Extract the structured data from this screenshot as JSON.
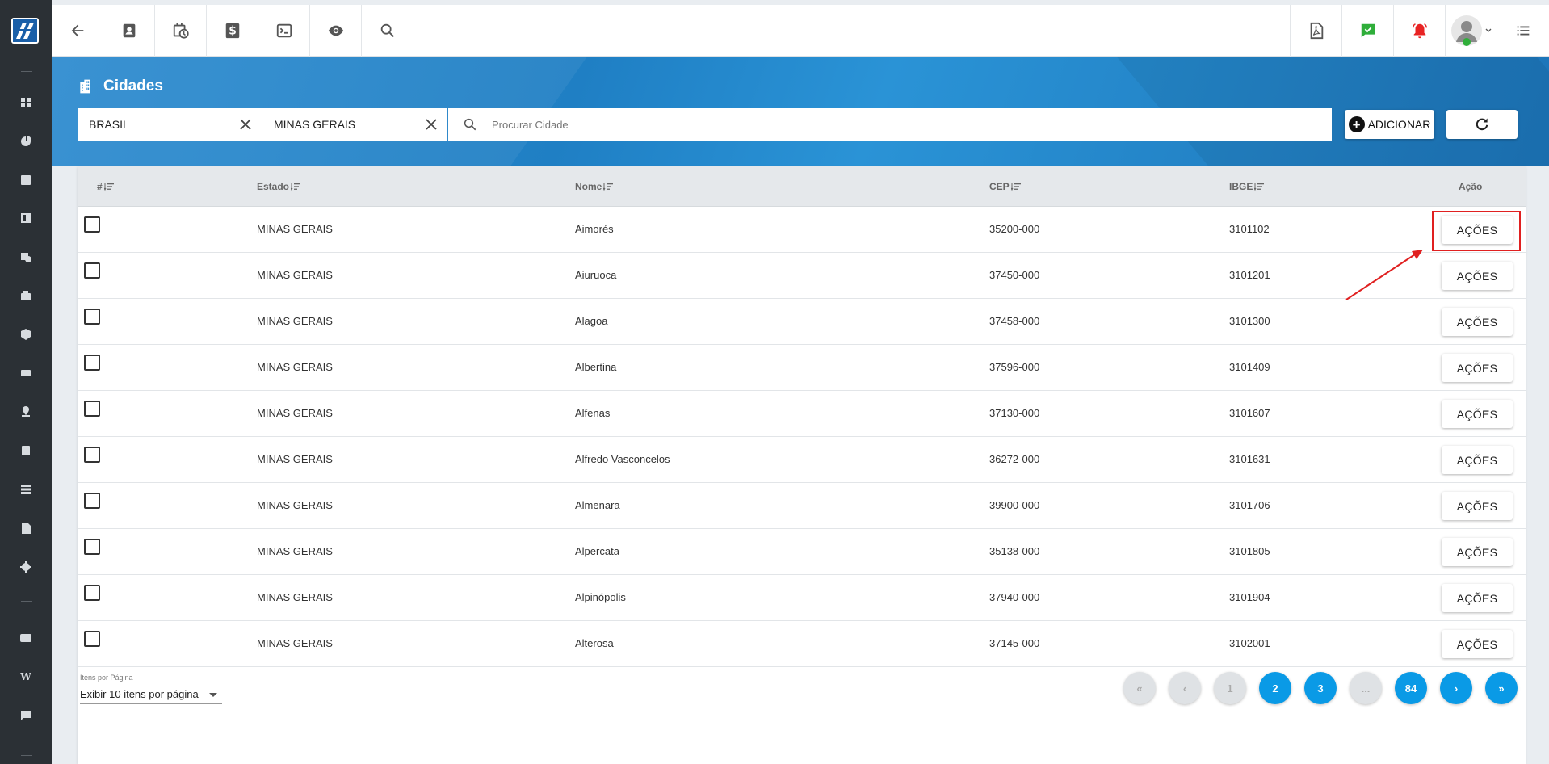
{
  "sidebar": {
    "icons": [
      "dashboard-icon",
      "pie-chart-icon",
      "contact-card-icon",
      "board-icon",
      "calendar-clock-icon",
      "briefcase-icon",
      "package-icon",
      "money-icon",
      "map-pin-icon",
      "document-list-icon",
      "server-icon",
      "file-icon",
      "gear-icon",
      "video-icon",
      "wiki-icon",
      "chat-icon"
    ],
    "wiki_letter": "W"
  },
  "topbar": {
    "left_icons": [
      "back-arrow-icon",
      "contact-icon",
      "calendar-clock-icon",
      "dollar-icon",
      "terminal-icon",
      "eye-icon",
      "search-icon"
    ],
    "right_icons": [
      "pdf-icon",
      "check-message-icon",
      "alarm-bell-icon",
      "user-avatar-icon",
      "menu-list-icon"
    ]
  },
  "page": {
    "title": "Cidades"
  },
  "filters": {
    "country": "BRASIL",
    "state": "MINAS GERAIS",
    "search_placeholder": "Procurar Cidade",
    "add_label": "ADICIONAR"
  },
  "table": {
    "columns": [
      "#",
      "Estado",
      "Nome",
      "CEP",
      "IBGE",
      "Ação"
    ],
    "action_label": "AÇÕES",
    "rows": [
      {
        "estado": "MINAS GERAIS",
        "nome": "Aimorés",
        "cep": "35200-000",
        "ibge": "3101102"
      },
      {
        "estado": "MINAS GERAIS",
        "nome": "Aiuruoca",
        "cep": "37450-000",
        "ibge": "3101201"
      },
      {
        "estado": "MINAS GERAIS",
        "nome": "Alagoa",
        "cep": "37458-000",
        "ibge": "3101300"
      },
      {
        "estado": "MINAS GERAIS",
        "nome": "Albertina",
        "cep": "37596-000",
        "ibge": "3101409"
      },
      {
        "estado": "MINAS GERAIS",
        "nome": "Alfenas",
        "cep": "37130-000",
        "ibge": "3101607"
      },
      {
        "estado": "MINAS GERAIS",
        "nome": "Alfredo Vasconcelos",
        "cep": "36272-000",
        "ibge": "3101631"
      },
      {
        "estado": "MINAS GERAIS",
        "nome": "Almenara",
        "cep": "39900-000",
        "ibge": "3101706"
      },
      {
        "estado": "MINAS GERAIS",
        "nome": "Alpercata",
        "cep": "35138-000",
        "ibge": "3101805"
      },
      {
        "estado": "MINAS GERAIS",
        "nome": "Alpinópolis",
        "cep": "37940-000",
        "ibge": "3101904"
      },
      {
        "estado": "MINAS GERAIS",
        "nome": "Alterosa",
        "cep": "37145-000",
        "ibge": "3102001"
      }
    ]
  },
  "footer": {
    "items_per_page_label": "Itens por Página",
    "items_per_page_value": "Exibir 10 itens por página",
    "pagination": [
      {
        "label": "«",
        "state": "disabled"
      },
      {
        "label": "‹",
        "state": "disabled"
      },
      {
        "label": "1",
        "state": "disabled"
      },
      {
        "label": "2",
        "state": "active"
      },
      {
        "label": "3",
        "state": "active"
      },
      {
        "label": "...",
        "state": "disabled"
      },
      {
        "label": "84",
        "state": "active"
      },
      {
        "label": "›",
        "state": "active"
      },
      {
        "label": "»",
        "state": "active"
      }
    ]
  },
  "colors": {
    "accent": "#0a9ae6",
    "sidebar": "#2b3035",
    "band": "#1f7fc4",
    "annotation": "#e02020"
  }
}
